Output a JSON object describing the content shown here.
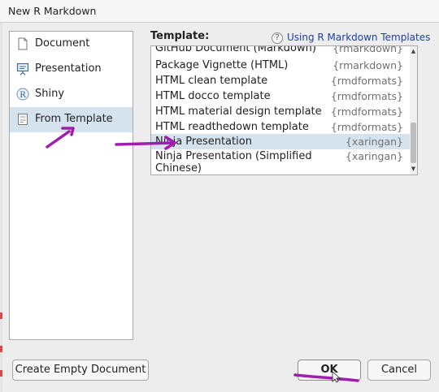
{
  "window": {
    "title": "New R Markdown"
  },
  "sidebar": {
    "items": [
      {
        "label": "Document",
        "icon": "document-icon",
        "selected": false
      },
      {
        "label": "Presentation",
        "icon": "presentation-icon",
        "selected": false
      },
      {
        "label": "Shiny",
        "icon": "shiny-r-icon",
        "selected": false
      },
      {
        "label": "From Template",
        "icon": "template-icon",
        "selected": true
      }
    ]
  },
  "template_panel": {
    "heading": "Template:",
    "help_icon": "?",
    "help_link": "Using R Markdown Templates",
    "templates": [
      {
        "name": "GitHub Document (Markdown)",
        "package": "{rmarkdown}"
      },
      {
        "name": "Package Vignette (HTML)",
        "package": "{rmarkdown}"
      },
      {
        "name": "HTML clean template",
        "package": "{rmdformats}"
      },
      {
        "name": "HTML docco template",
        "package": "{rmdformats}"
      },
      {
        "name": "HTML material design template",
        "package": "{rmdformats}"
      },
      {
        "name": "HTML readthedown template",
        "package": "{rmdformats}"
      },
      {
        "name": "Ninja Presentation",
        "package": "{xaringan}",
        "selected": true
      },
      {
        "name": "Ninja Presentation (Simplified\nChinese)",
        "package": "{xaringan}"
      }
    ],
    "scroll_arrows": {
      "up": "▲",
      "down": "▼"
    }
  },
  "buttons": {
    "create_empty": "Create Empty Document",
    "ok": "OK",
    "cancel": "Cancel"
  },
  "colors": {
    "selection": "#d5e3ef",
    "annotation": "#a21caf",
    "link": "#1b3fa8"
  }
}
